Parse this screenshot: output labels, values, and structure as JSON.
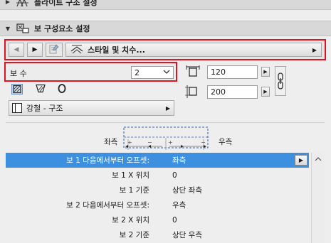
{
  "sections": {
    "top_partial_label": "플라이트 구조 설정",
    "beam_components_label": "보 구성요소 설정"
  },
  "toolbar": {
    "style_label": "스타일 및 치수..."
  },
  "count": {
    "label": "보 수",
    "value": "2"
  },
  "dimensions": {
    "width_value": "120",
    "height_value": "200"
  },
  "material": {
    "label": "강철 - 구조"
  },
  "diagram": {
    "left_label": "좌측",
    "right_label": "우측",
    "plus": "+",
    "minus": "−"
  },
  "table": {
    "rows": [
      {
        "name": "보 1 다음에서부터 오프셋:",
        "value": "좌측",
        "selected": true
      },
      {
        "name": "보 1 X 위치",
        "value": "0"
      },
      {
        "name": "보 1 기준",
        "value": "상단 좌측"
      },
      {
        "name": "보 2 다음에서부터 오프셋:",
        "value": "우측"
      },
      {
        "name": "보 2 X 위치",
        "value": "0"
      },
      {
        "name": "보 2 기준",
        "value": "상단 우측"
      }
    ]
  },
  "colors": {
    "highlight_red": "#e0141e",
    "selection_blue": "#3d8fdf"
  }
}
